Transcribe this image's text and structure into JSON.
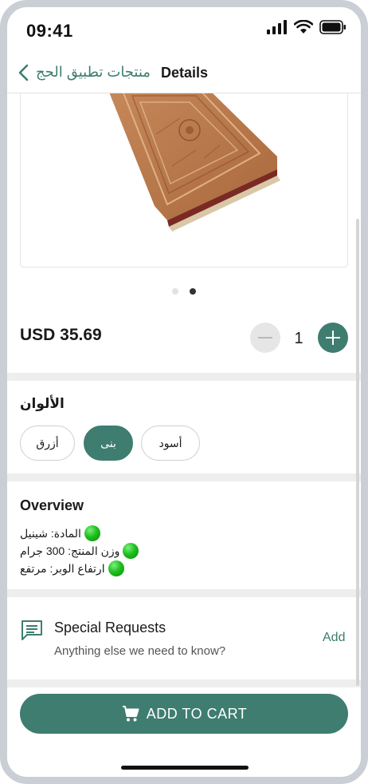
{
  "status_bar": {
    "time": "09:41"
  },
  "nav": {
    "back_label": "منتجات تطبيق الحج",
    "title": "Details"
  },
  "product": {
    "price": "USD 35.69",
    "quantity": "1",
    "carousel": {
      "page_count": 2,
      "active_index": 1
    }
  },
  "colors": {
    "title": "الألوان",
    "options": [
      {
        "label": "أسود",
        "selected": false
      },
      {
        "label": "بنى",
        "selected": true
      },
      {
        "label": "أزرق",
        "selected": false
      }
    ]
  },
  "overview": {
    "title": "Overview",
    "lines": [
      "المادة: شينيل",
      "وزن المنتج: 300 جرام",
      "ارتفاع الوبر: مرتفع"
    ]
  },
  "special_requests": {
    "title": "Special Requests",
    "subtitle": "Anything else we need to know?",
    "action": "Add",
    "icon": "comment-icon"
  },
  "cart": {
    "button_label": "ADD TO CART",
    "icon": "cart-icon"
  },
  "theme": {
    "accent": "#3e7d6f",
    "rug": "#b87a4b"
  }
}
